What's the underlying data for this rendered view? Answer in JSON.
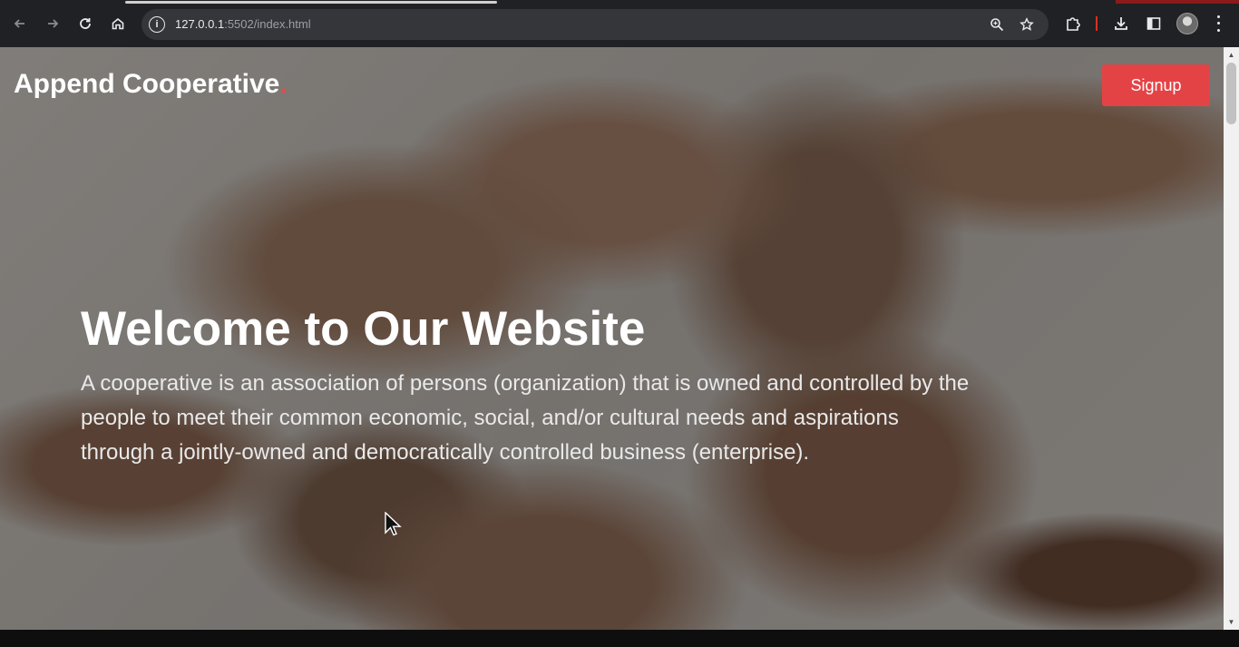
{
  "browser": {
    "url_host": "127.0.0.1",
    "url_rest": ":5502/index.html",
    "icons": {
      "back": "back-arrow-icon",
      "forward": "forward-arrow-icon",
      "reload": "reload-icon",
      "home": "home-icon",
      "site_info": "info-icon",
      "zoom": "zoom-icon",
      "bookmark": "star-icon",
      "extensions": "puzzle-icon",
      "downloads": "download-icon",
      "side_panel": "side-panel-icon",
      "profile": "avatar",
      "menu": "kebab-menu-icon"
    }
  },
  "header": {
    "brand": "Append Cooperative",
    "brand_dot": ".",
    "signup_label": "Signup"
  },
  "hero": {
    "title": "Welcome to Our Website",
    "text": "A cooperative is an association of persons (organization) that is owned and controlled by the people to meet their common economic, social, and/or cultural needs and aspirations through a jointly-owned and democratically controlled business (enterprise).",
    "background_image": "hands-linked-in-circle-photo"
  },
  "colors": {
    "accent": "#e44346",
    "chrome_bg": "#202124",
    "omnibox_bg": "#35363a"
  }
}
